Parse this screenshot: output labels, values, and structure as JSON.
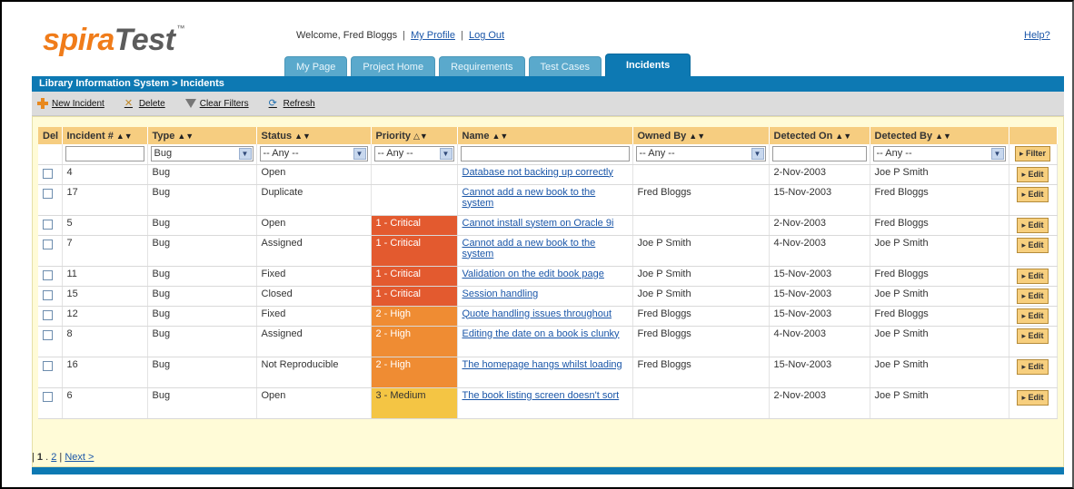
{
  "header": {
    "logo_main": "spira",
    "logo_accent": "Test",
    "logo_tm": "™",
    "welcome": "Welcome, Fred Bloggs",
    "my_profile": "My Profile",
    "log_out": "Log Out",
    "help": "Help?"
  },
  "tabs": [
    {
      "label": "My Page"
    },
    {
      "label": "Project Home"
    },
    {
      "label": "Requirements"
    },
    {
      "label": "Test Cases"
    },
    {
      "label": "Incidents",
      "active": true
    }
  ],
  "breadcrumb": "Library Information System > Incidents",
  "toolbar": {
    "new_incident": "New Incident",
    "delete": "Delete",
    "clear_filters": "Clear Filters",
    "refresh": "Refresh"
  },
  "columns": {
    "del": "Del",
    "incident": "Incident #",
    "type": "Type",
    "status": "Status",
    "priority": "Priority",
    "name": "Name",
    "owned_by": "Owned By",
    "detected_on": "Detected On",
    "detected_by": "Detected By"
  },
  "filters": {
    "type": "Bug",
    "status": "-- Any --",
    "priority": "-- Any --",
    "owned_by": "-- Any --",
    "detected_by": "-- Any --",
    "filter_button": "▸ Filter"
  },
  "edit_label": "▸ Edit",
  "rows": [
    {
      "id": "4",
      "type": "Bug",
      "status": "Open",
      "priority": "",
      "name": "Database not backing up correctly",
      "owned_by": "",
      "detected_on": "2-Nov-2003",
      "detected_by": "Joe P Smith"
    },
    {
      "id": "17",
      "type": "Bug",
      "status": "Duplicate",
      "priority": "",
      "name": "Cannot add a new book to the system",
      "owned_by": "Fred Bloggs",
      "detected_on": "15-Nov-2003",
      "detected_by": "Fred Bloggs"
    },
    {
      "id": "5",
      "type": "Bug",
      "status": "Open",
      "priority": "1 - Critical",
      "name": "Cannot install system on Oracle 9i",
      "owned_by": "",
      "detected_on": "2-Nov-2003",
      "detected_by": "Fred Bloggs"
    },
    {
      "id": "7",
      "type": "Bug",
      "status": "Assigned",
      "priority": "1 - Critical",
      "name": "Cannot add a new book to the system",
      "owned_by": "Joe P Smith",
      "detected_on": "4-Nov-2003",
      "detected_by": "Joe P Smith"
    },
    {
      "id": "11",
      "type": "Bug",
      "status": "Fixed",
      "priority": "1 - Critical",
      "name": "Validation on the edit book page",
      "owned_by": "Joe P Smith",
      "detected_on": "15-Nov-2003",
      "detected_by": "Fred Bloggs"
    },
    {
      "id": "15",
      "type": "Bug",
      "status": "Closed",
      "priority": "1 - Critical",
      "name": "Session handling",
      "owned_by": "Joe P Smith",
      "detected_on": "15-Nov-2003",
      "detected_by": "Joe P Smith"
    },
    {
      "id": "12",
      "type": "Bug",
      "status": "Fixed",
      "priority": "2 - High",
      "name": "Quote handling issues throughout",
      "owned_by": "Fred Bloggs",
      "detected_on": "15-Nov-2003",
      "detected_by": "Fred Bloggs"
    },
    {
      "id": "8",
      "type": "Bug",
      "status": "Assigned",
      "priority": "2 - High",
      "name": "Editing the date on a book is clunky",
      "owned_by": "Fred Bloggs",
      "detected_on": "4-Nov-2003",
      "detected_by": "Joe P Smith"
    },
    {
      "id": "16",
      "type": "Bug",
      "status": "Not Reproducible",
      "priority": "2 - High",
      "name": "The homepage hangs whilst loading",
      "owned_by": "Fred Bloggs",
      "detected_on": "15-Nov-2003",
      "detected_by": "Joe P Smith"
    },
    {
      "id": "6",
      "type": "Bug",
      "status": "Open",
      "priority": "3 - Medium",
      "name": "The book listing screen doesn't sort",
      "owned_by": "",
      "detected_on": "2-Nov-2003",
      "detected_by": "Joe P Smith"
    }
  ],
  "pager": {
    "current": "1",
    "page2": "2",
    "next": "Next >"
  },
  "colors": {
    "brand_blue": "#0d79b3",
    "critical": "#e35a2f",
    "high": "#ef8c33",
    "medium": "#f4c544",
    "header_row": "#f6cd80"
  }
}
